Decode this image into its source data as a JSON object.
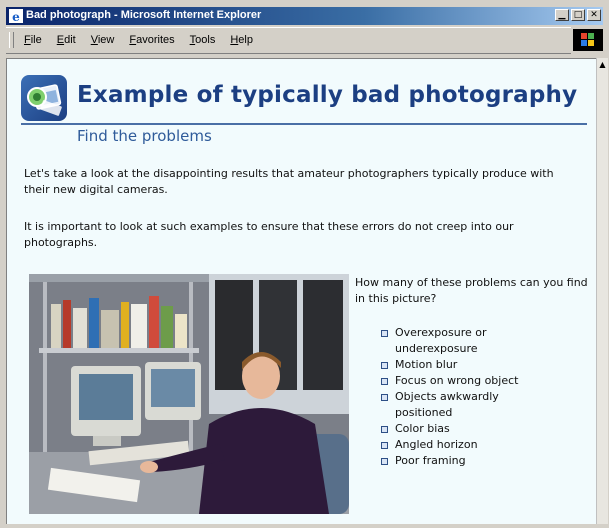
{
  "window": {
    "title": "Bad photograph - Microsoft Internet Explorer",
    "controls": [
      "minimize",
      "maximize",
      "close"
    ]
  },
  "menu": [
    {
      "label": "File"
    },
    {
      "label": "Edit"
    },
    {
      "label": "View"
    },
    {
      "label": "Favorites"
    },
    {
      "label": "Tools"
    },
    {
      "label": "Help"
    }
  ],
  "page": {
    "heading": "Example of typically bad photography",
    "subheading": "Find the problems",
    "paragraphs": [
      "Let's take a look at the disappointing results that amateur photographers typically produce with their new digital cameras.",
      "It is important to look at such examples to ensure that these errors do not creep into our photographs."
    ],
    "question": "How many of these problems can you find in this picture?",
    "problems": [
      "Overexposure or underexposure",
      "Motion blur",
      "Focus on wrong object",
      "Objects awkwardly positioned",
      "Color bias",
      "Angled horizon",
      "Poor framing"
    ]
  },
  "colors": {
    "title_bar": "#0a246a",
    "heading": "#1c3f82",
    "page_background": "#f2fbfd"
  }
}
